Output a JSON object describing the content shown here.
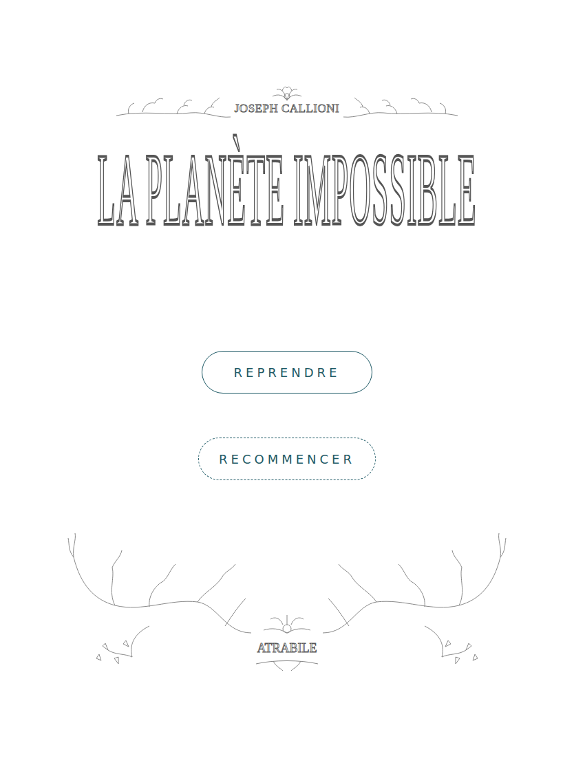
{
  "book": {
    "author": "JOSEPH CALLIONI",
    "title": "LA PLANÈTE IMPOSSIBLE",
    "publisher": "ATRABILE"
  },
  "buttons": [
    {
      "label": "REPRENDRE",
      "kind": "solid"
    },
    {
      "label": "RECOMMENCER",
      "kind": "dashed"
    }
  ]
}
